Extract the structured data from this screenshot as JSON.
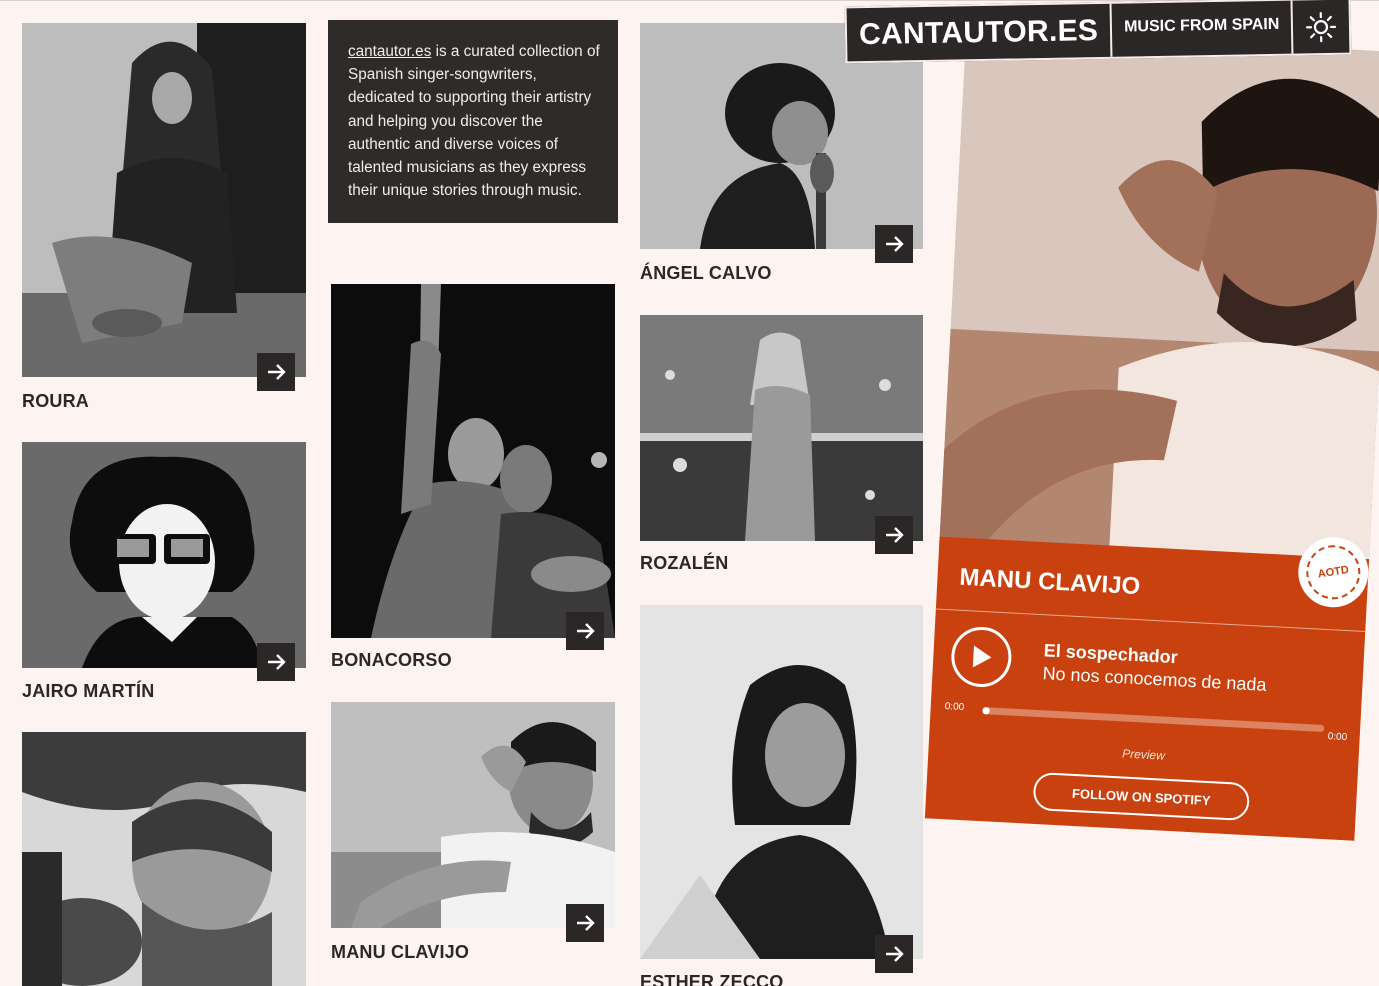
{
  "site": {
    "logo": "CANTAUTOR.ES",
    "tagline": "MUSIC FROM SPAIN",
    "theme_icon": "sun-icon"
  },
  "intro": {
    "link_text": "cantautor.es",
    "text": " is a curated collection of Spanish singer-songwriters, dedicated to supporting their artistry and helping you discover the authentic and diverse voices of talented musicians as they express their unique stories through music."
  },
  "artists": [
    {
      "name": "ROURA"
    },
    {
      "name": "JAIRO MARTÍN"
    },
    {
      "name": "BONACORSO"
    },
    {
      "name": "MANU CLAVIJO"
    },
    {
      "name": "ÁNGEL CALVO"
    },
    {
      "name": "ROZALÉN"
    },
    {
      "name": "ESTHER ZECCO"
    }
  ],
  "featured": {
    "name": "MANU CLAVIJO",
    "badge": "AOTD",
    "track_title": "El sospechador",
    "album": "No nos conocemos de nada",
    "time_current": "0:00",
    "time_total": "0:00",
    "progress_fraction": 0.02,
    "preview_label": "Preview",
    "follow_label": "FOLLOW ON SPOTIFY"
  },
  "icons": {
    "card_arrow": "arrow-right-icon",
    "play": "play-icon"
  }
}
